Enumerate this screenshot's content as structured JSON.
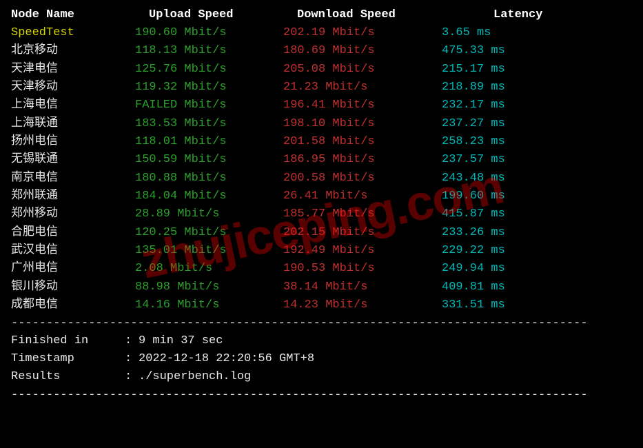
{
  "headers": {
    "node": "Node Name",
    "upload": "Upload Speed",
    "download": "Download Speed",
    "latency": "Latency"
  },
  "speedtest_row": {
    "node": "SpeedTest",
    "upload": "190.60 Mbit/s",
    "download": "202.19 Mbit/s",
    "latency": "3.65 ms"
  },
  "rows": [
    {
      "node": "北京移动",
      "upload": "118.13 Mbit/s",
      "download": "180.69 Mbit/s",
      "latency": "475.33 ms"
    },
    {
      "node": "天津电信",
      "upload": "125.76 Mbit/s",
      "download": "205.08 Mbit/s",
      "latency": "215.17 ms"
    },
    {
      "node": "天津移动",
      "upload": "119.32 Mbit/s",
      "download": "21.23 Mbit/s",
      "latency": "218.89 ms"
    },
    {
      "node": "上海电信",
      "upload": "FAILED Mbit/s",
      "download": "196.41 Mbit/s",
      "latency": "232.17 ms"
    },
    {
      "node": "上海联通",
      "upload": "183.53 Mbit/s",
      "download": "198.10 Mbit/s",
      "latency": "237.27 ms"
    },
    {
      "node": "扬州电信",
      "upload": "118.01 Mbit/s",
      "download": "201.58 Mbit/s",
      "latency": "258.23 ms"
    },
    {
      "node": "无锡联通",
      "upload": "150.59 Mbit/s",
      "download": "186.95 Mbit/s",
      "latency": "237.57 ms"
    },
    {
      "node": "南京电信",
      "upload": "180.88 Mbit/s",
      "download": "200.58 Mbit/s",
      "latency": "243.48 ms"
    },
    {
      "node": "郑州联通",
      "upload": "184.04 Mbit/s",
      "download": "26.41 Mbit/s",
      "latency": "199.60 ms"
    },
    {
      "node": "郑州移动",
      "upload": "28.89 Mbit/s",
      "download": "185.77 Mbit/s",
      "latency": "415.87 ms"
    },
    {
      "node": "合肥电信",
      "upload": "120.25 Mbit/s",
      "download": "202.15 Mbit/s",
      "latency": "233.26 ms"
    },
    {
      "node": "武汉电信",
      "upload": "135.01 Mbit/s",
      "download": "192.49 Mbit/s",
      "latency": "229.22 ms"
    },
    {
      "node": "广州电信",
      "upload": "2.08 Mbit/s",
      "download": "190.53 Mbit/s",
      "latency": "249.94 ms"
    },
    {
      "node": "银川移动",
      "upload": "88.98 Mbit/s",
      "download": "38.14 Mbit/s",
      "latency": "409.81 ms"
    },
    {
      "node": "成都电信",
      "upload": "14.16 Mbit/s",
      "download": "14.23 Mbit/s",
      "latency": "331.51 ms"
    }
  ],
  "divider": "----------------------------------------------------------------------------------",
  "footer": {
    "finished_label": "Finished in",
    "finished_value": "9 min 37 sec",
    "timestamp_label": "Timestamp",
    "timestamp_value": "2022-12-18 22:20:56 GMT+8",
    "results_label": "Results",
    "results_value": "./superbench.log",
    "colon": ":"
  },
  "watermark": "zhujiceping.com"
}
